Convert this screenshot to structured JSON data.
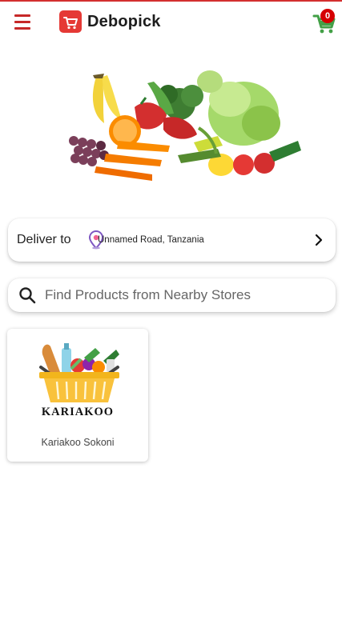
{
  "header": {
    "brand": "Debopick",
    "cart_count": "0",
    "icons": {
      "menu": "hamburger-menu-icon",
      "logo": "debopick-cart-logo-icon",
      "cart": "shopping-cart-icon"
    }
  },
  "hero": {
    "image": "fresh-vegetables-and-fruits-illustration"
  },
  "delivery": {
    "label": "Deliver to",
    "address": "Unnamed Road, Tanzania",
    "icons": {
      "pin": "location-pin-icon",
      "chevron": "chevron-right-icon"
    }
  },
  "search": {
    "placeholder": "Find Products from Nearby Stores",
    "value": "",
    "icon": "search-icon"
  },
  "stores": [
    {
      "logo_text": "KARIAKOO",
      "name": "Kariakoo Sokoni",
      "logo": "grocery-basket-logo"
    }
  ],
  "colors": {
    "accent": "#c62828",
    "logo_red": "#e53935",
    "cart_green": "#43a047",
    "badge_red": "#d50000",
    "pin_purple": "#7e57c2",
    "basket_yellow": "#f9c23c"
  }
}
